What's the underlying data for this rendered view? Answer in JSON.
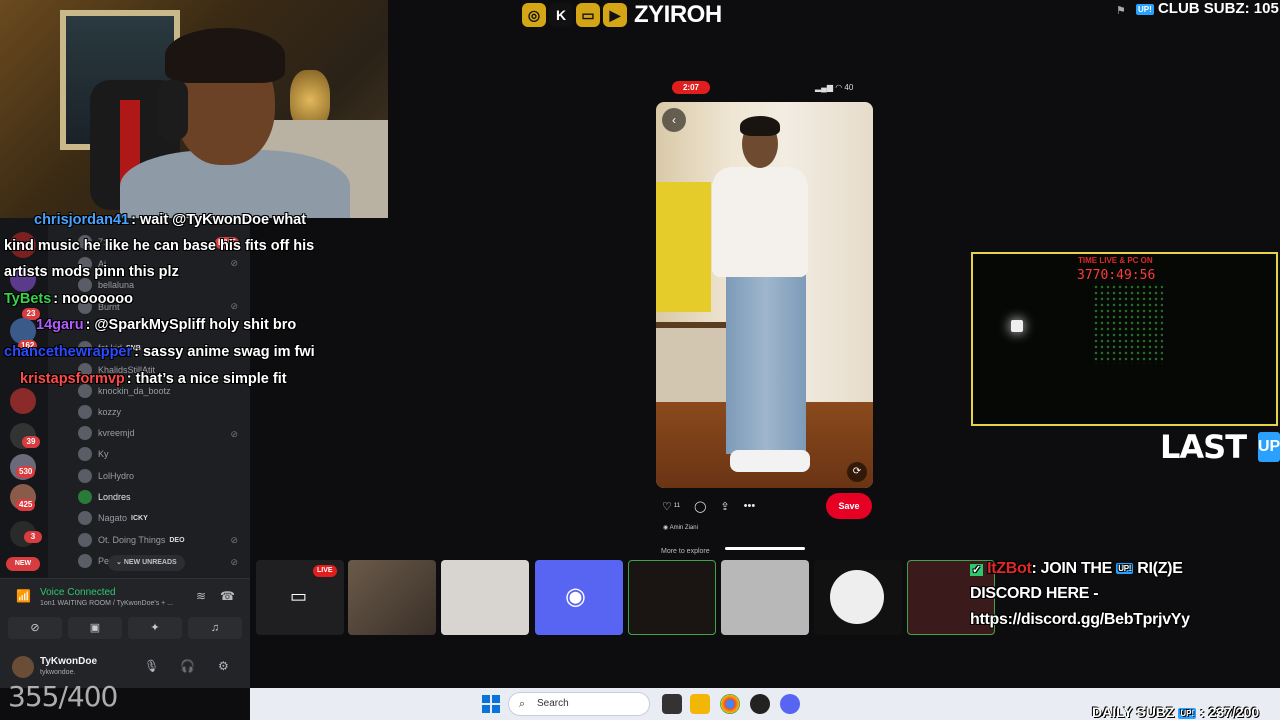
{
  "header": {
    "brand_name": "ZYIROH",
    "club_subs": "CLUB SUBZ: 105",
    "up_tag": "UP!"
  },
  "chat": [
    {
      "user": "chrisjordan41",
      "user_color": "#4aa3ff",
      "text": ": wait @TyKwonDoe what"
    },
    {
      "user": "",
      "user_color": "#fff",
      "text": "kind music he like he can base his fits off his"
    },
    {
      "user": "",
      "user_color": "#fff",
      "text": "artists mods pinn this plz"
    },
    {
      "user": "TyBets",
      "user_color": "#37d14a",
      "text": ": nooooooo"
    },
    {
      "user": "14garu",
      "user_color": "#b05cff",
      "text": ": @SparkMySpliff holy shit bro"
    },
    {
      "user": "chancethewrapper",
      "user_color": "#2b4bff",
      "text": ": sassy anime swag im fwi"
    },
    {
      "user": "kristapsformvp",
      "user_color": "#ff4a4a",
      "text": ": that’s a nice simple fit"
    }
  ],
  "discord": {
    "members": [
      {
        "name": "7:00",
        "tag": ""
      },
      {
        "name": "Aj",
        "tag": ""
      },
      {
        "name": "bellaluna",
        "tag": ""
      },
      {
        "name": "Burnt",
        "tag": ""
      },
      {
        "name": "fat kid",
        "tag": "SNB"
      },
      {
        "name": "KhalidsStillAtit",
        "tag": ""
      },
      {
        "name": "knockin_da_bootz",
        "tag": ""
      },
      {
        "name": "kozzy",
        "tag": ""
      },
      {
        "name": "kvreemjd",
        "tag": ""
      },
      {
        "name": "Ky",
        "tag": ""
      },
      {
        "name": "LolHydro",
        "tag": ""
      },
      {
        "name": "Londres",
        "tag": ""
      },
      {
        "name": "Nagato",
        "tag": "ICKY"
      },
      {
        "name": "Ot. Doing Things",
        "tag": "DEO"
      },
      {
        "name": "Pe",
        "tag": ""
      }
    ],
    "guild_badges": [
      "23",
      "162",
      "39",
      "530",
      "425",
      "3"
    ],
    "live_label": "LIVE",
    "new_pill": "NEW",
    "new_unreads": "NEW UNREADS",
    "voice_status": "Voice Connected",
    "voice_channel": "1on1 WAITING ROOM / TyKwonDoe's + ...",
    "user_name": "TyKwonDoe",
    "user_tag": "tykwondoe."
  },
  "sub_goal": "355/400",
  "phone": {
    "time": "2:07",
    "status": "40",
    "like_count": "11",
    "save_label": "Save",
    "author": "Amin Ziani",
    "more_explore": "More to explore"
  },
  "cam2": {
    "label": "TIME LIVE & PC ON",
    "timer": "3770:49:56"
  },
  "last_label": "LAST",
  "story_live": "LIVE",
  "discord_banner": {
    "bot": "ItZBot",
    "line1": ": JOIN THE",
    "line1b": "RI(Z)E",
    "line2": "DISCORD HERE -",
    "line3": "https://discord.gg/BebTprjvYy"
  },
  "taskbar": {
    "search_placeholder": "Search"
  },
  "daily_subs": "DAILY SUBZ",
  "daily_count": ": 237/200"
}
